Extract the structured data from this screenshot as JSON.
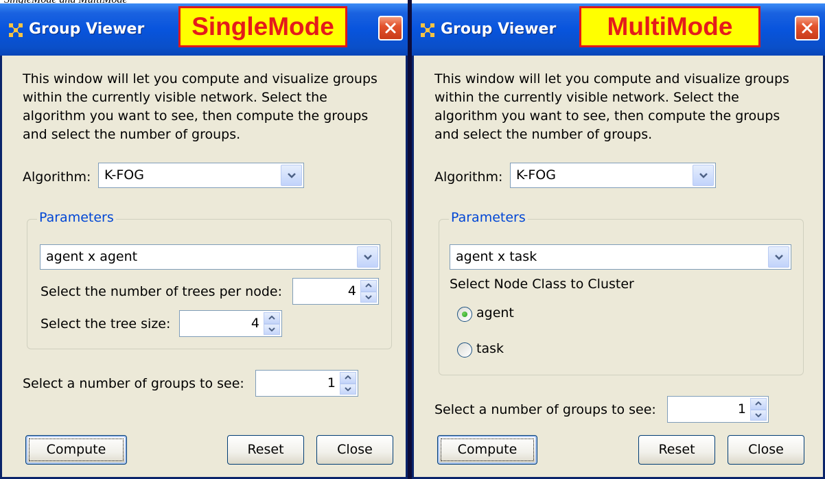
{
  "caption": "SingleMode and MultiMode",
  "windows": [
    {
      "title": "Group Viewer",
      "mode": "SingleMode",
      "description": "This window will let you compute and visualize groups\nwithin the currently visible network. Select the\nalgorithm you want to see, then compute the groups\nand select the number of groups.",
      "algorithm_label": "Algorithm:",
      "algorithm_value": "K-FOG",
      "parameters_title": "Parameters",
      "parameters_value": "agent x agent",
      "trees_label": "Select the number of trees per node:",
      "trees_value": "4",
      "tree_size_label": "Select the tree size:",
      "tree_size_value": "4",
      "groups_label": "Select a number of groups to see:",
      "groups_value": "1",
      "compute_label": "Compute",
      "reset_label": "Reset",
      "close_label": "Close"
    },
    {
      "title": "Group Viewer",
      "mode": "MultiMode",
      "description": "This window will let you compute and visualize groups\nwithin the currently visible network. Select the\nalgorithm you want to see, then compute the groups\nand select the number of groups.",
      "algorithm_label": "Algorithm:",
      "algorithm_value": "K-FOG",
      "parameters_title": "Parameters",
      "parameters_value": "agent x task",
      "node_class_label": "Select Node Class to Cluster",
      "radio_options": [
        {
          "label": "agent",
          "checked": true
        },
        {
          "label": "task",
          "checked": false
        }
      ],
      "groups_label": "Select a number of groups to see:",
      "groups_value": "1",
      "compute_label": "Compute",
      "reset_label": "Reset",
      "close_label": "Close"
    }
  ],
  "colors": {
    "title_bar": "#0854dd",
    "badge_fill": "#ffff00",
    "badge_text": "#e41b1b",
    "group_title": "#0046d5",
    "window_bg": "#ece9d8"
  }
}
